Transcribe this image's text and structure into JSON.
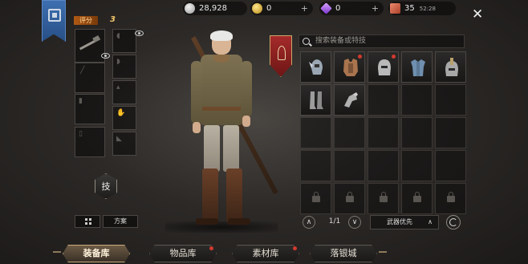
{
  "currencies": [
    {
      "icon": "silver-coin-icon",
      "value": "28,928"
    },
    {
      "icon": "gold-coin-icon",
      "value": "0"
    },
    {
      "icon": "purple-gem-icon",
      "value": "0"
    },
    {
      "icon": "ticket-icon",
      "value": "35",
      "timer": "52:28"
    }
  ],
  "close_label": "✕",
  "loadout": {
    "score_label": "评分",
    "score_value": "3",
    "skill_label": "技",
    "plan_label": "方案"
  },
  "search": {
    "placeholder": "搜索装备或特技"
  },
  "inventory": {
    "items": [
      {
        "name": "winged-helmet",
        "color": "#9aa6b3",
        "new": false
      },
      {
        "name": "armored-vest",
        "color": "#a9744e",
        "new": true
      },
      {
        "name": "steel-helm",
        "color": "#b9b9b9",
        "new": true
      },
      {
        "name": "cloth-tunic",
        "color": "#6f8fae",
        "new": false
      },
      {
        "name": "gold-crested-helm",
        "color": "#b8a06a",
        "new": false
      },
      {
        "name": "steel-boots",
        "color": "#9c9c9c",
        "new": false
      },
      {
        "name": "gauntlet",
        "color": "#b0b0b0",
        "new": false
      }
    ],
    "page": "1/1",
    "sort_label": "武器优先"
  },
  "tabs": [
    {
      "label": "装备库",
      "active": true,
      "badge": false
    },
    {
      "label": "物品库",
      "active": false,
      "badge": true
    },
    {
      "label": "素材库",
      "active": false,
      "badge": true
    },
    {
      "label": "落银城",
      "active": false,
      "badge": false
    }
  ],
  "colors": {
    "accent": "#f2c86b",
    "badge": "#d23a2f",
    "banner": "#3d6fb0",
    "crest": "#a52a2a"
  }
}
